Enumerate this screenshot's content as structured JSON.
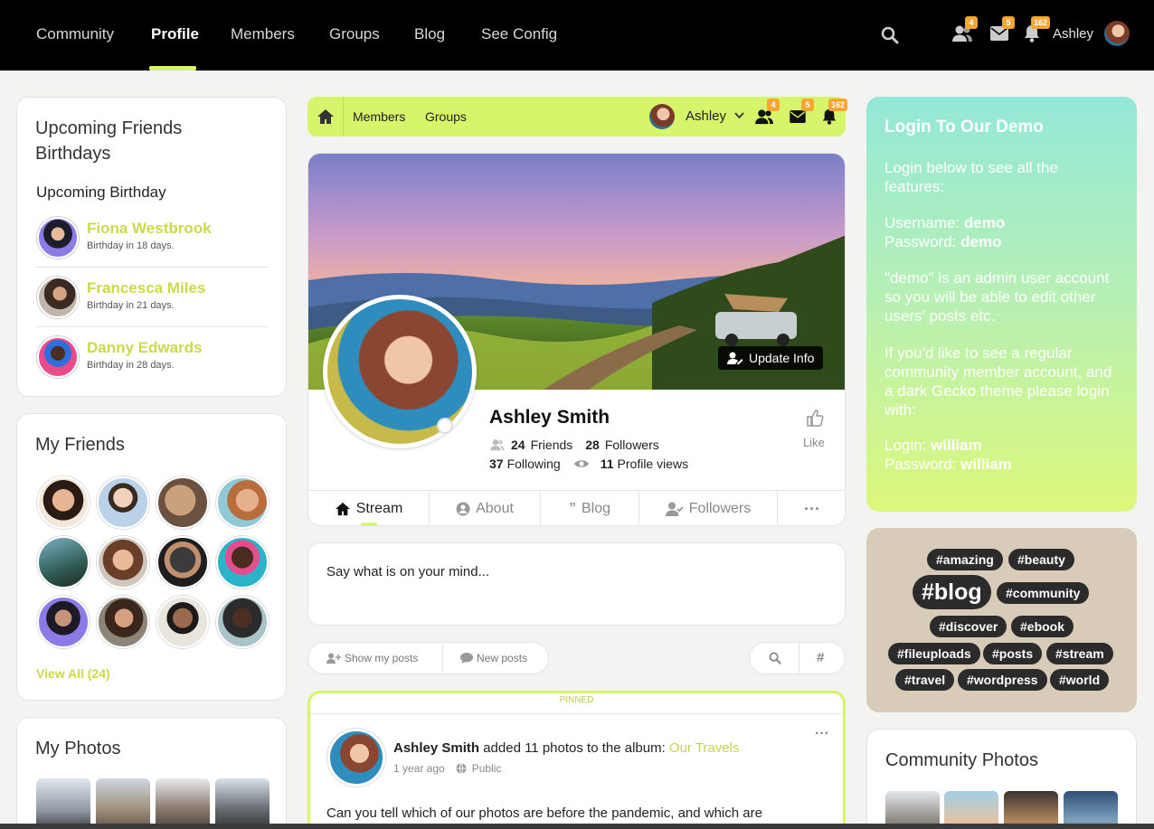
{
  "topnav": {
    "links": [
      "Community",
      "Profile",
      "Members",
      "Groups",
      "Blog",
      "See Config"
    ],
    "active": "Profile",
    "friend_requests": "4",
    "messages": "5",
    "notifications": "162",
    "user_name": "Ashley"
  },
  "subnav": {
    "links": [
      "Members",
      "Groups"
    ],
    "user_name": "Ashley",
    "friend_requests": "4",
    "messages": "5",
    "notifications": "162"
  },
  "birthdays": {
    "title": "Upcoming Friends Birthdays",
    "subtitle": "Upcoming Birthday",
    "items": [
      {
        "name": "Fiona Westbrook",
        "when": "Birthday in 18 days."
      },
      {
        "name": "Francesca Miles",
        "when": "Birthday in 21 days."
      },
      {
        "name": "Danny Edwards",
        "when": "Birthday in 28 days."
      }
    ]
  },
  "friends": {
    "title": "My Friends",
    "view_all": "View All (24)"
  },
  "photos": {
    "title": "My Photos"
  },
  "profile": {
    "update_button": "Update Info",
    "name": "Ashley Smith",
    "friends_count": "24",
    "friends_label": "Friends",
    "followers_count": "28",
    "followers_label": "Followers",
    "following_count": "37",
    "following_label": "Following",
    "views_count": "11",
    "views_label": "Profile views",
    "like_label": "Like"
  },
  "tabs": [
    "Stream",
    "About",
    "Blog",
    "Followers"
  ],
  "composer": {
    "placeholder": "Say what is on your mind..."
  },
  "filters": {
    "show_my_posts": "Show my posts",
    "new_posts": "New posts"
  },
  "post": {
    "pinned_label": "PINNED",
    "author": "Ashley Smith",
    "action": "added 11 photos to the album:",
    "album": "Our Travels",
    "time": "1 year ago",
    "privacy": "Public",
    "body": "Can you tell which of our photos are before the pandemic, and which are"
  },
  "demo": {
    "title": "Login To Our Demo",
    "intro": "Login below to see all the features:",
    "username_label": "Username:",
    "username": "demo",
    "password_label": "Password:",
    "password": "demo",
    "admin_note": "\"demo\" is an admin user account so you will be able to edit other users' posts etc.",
    "regular_note": "If you'd like to see a regular community member account, and a dark Gecko theme please login with:",
    "login_label": "Login:",
    "login": "william",
    "password2_label": "Password:",
    "password2": "william"
  },
  "tags": [
    "#amazing",
    "#beauty",
    "#blog",
    "#community",
    "#discover",
    "#ebook",
    "#fileuploads",
    "#posts",
    "#stream",
    "#travel",
    "#wordpress",
    "#world"
  ],
  "community_photos": {
    "title": "Community Photos"
  },
  "colors": {
    "accent": "#d6f56a",
    "name_link": "#cbd94a",
    "badge": "#f6a633"
  }
}
